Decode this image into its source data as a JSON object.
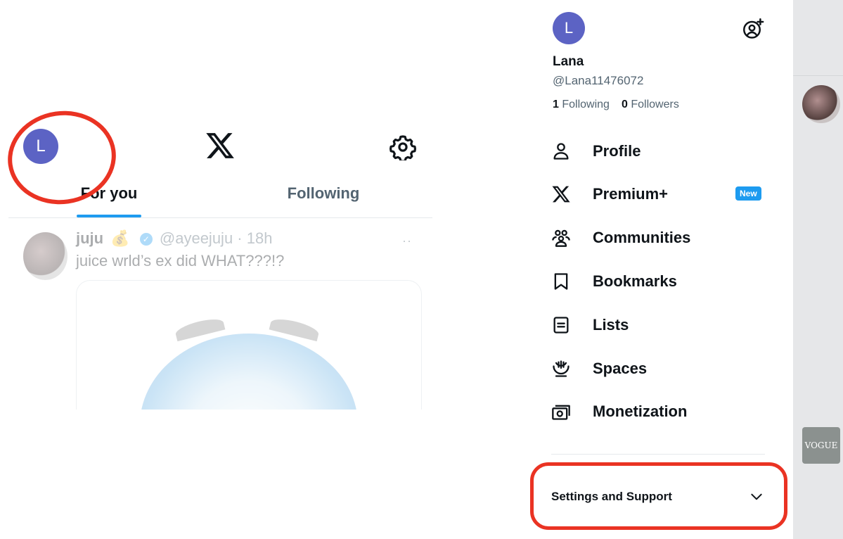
{
  "home": {
    "avatar_letter": "L",
    "tabs": [
      {
        "label": "For you",
        "active": true
      },
      {
        "label": "Following",
        "active": false
      }
    ]
  },
  "tweet": {
    "name": "juju",
    "emoji": "💰",
    "handle_time": "@ayeejuju · 18h",
    "text": "juice wrld’s ex did WHAT???!?",
    "more": "··"
  },
  "drawer": {
    "avatar_letter": "L",
    "name": "Lana",
    "handle": "@Lana11476072",
    "following_count": "1",
    "following_label": "Following",
    "followers_count": "0",
    "followers_label": "Followers",
    "menu": [
      {
        "label": "Profile",
        "icon": "person-icon"
      },
      {
        "label": "Premium+",
        "icon": "x-icon",
        "badge": "New"
      },
      {
        "label": "Communities",
        "icon": "communities-icon"
      },
      {
        "label": "Bookmarks",
        "icon": "bookmark-icon"
      },
      {
        "label": "Lists",
        "icon": "list-icon"
      },
      {
        "label": "Spaces",
        "icon": "spaces-icon"
      },
      {
        "label": "Monetization",
        "icon": "money-icon"
      }
    ],
    "settings_label": "Settings and Support"
  },
  "right_strip": {
    "ad_text": "VOGUE"
  },
  "colors": {
    "accent": "#1d9bf0",
    "avatar": "#5c63c4",
    "annotation_red": "#ea3323"
  }
}
